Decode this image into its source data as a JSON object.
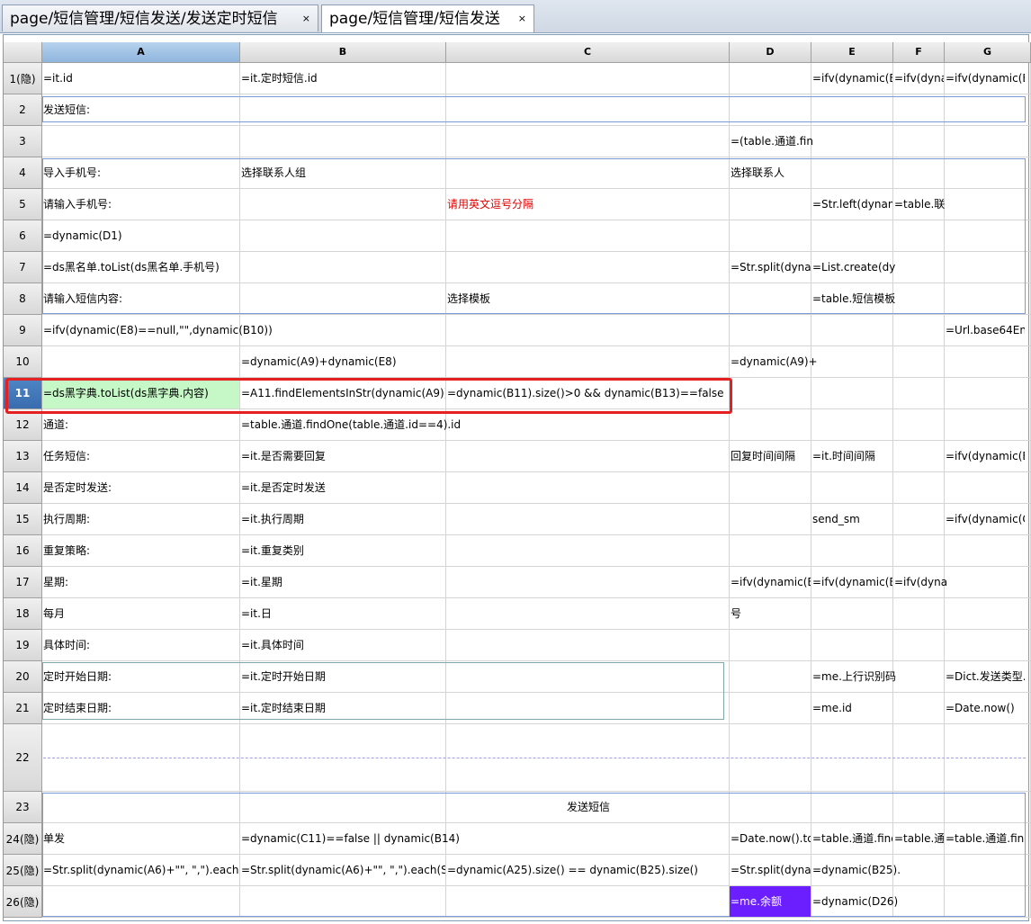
{
  "tabs": [
    {
      "label": "page/短信管理/短信发送/发送定时短信",
      "active": false
    },
    {
      "label": "page/短信管理/短信发送",
      "active": true
    }
  ],
  "close_glyph": "×",
  "columns": [
    "A",
    "B",
    "C",
    "D",
    "E",
    "F",
    "G"
  ],
  "selected_column": "A",
  "selected_row": 11,
  "rows": [
    {
      "n": 1,
      "label": "1(隐)",
      "h": 35
    },
    {
      "n": 2,
      "label": "2",
      "h": 35
    },
    {
      "n": 3,
      "label": "3",
      "h": 35
    },
    {
      "n": 4,
      "label": "4",
      "h": 35
    },
    {
      "n": 5,
      "label": "5",
      "h": 35
    },
    {
      "n": 6,
      "label": "6",
      "h": 35
    },
    {
      "n": 7,
      "label": "7",
      "h": 35
    },
    {
      "n": 8,
      "label": "8",
      "h": 35
    },
    {
      "n": 9,
      "label": "9",
      "h": 35
    },
    {
      "n": 10,
      "label": "10",
      "h": 35
    },
    {
      "n": 11,
      "label": "11",
      "h": 35
    },
    {
      "n": 12,
      "label": "12",
      "h": 35
    },
    {
      "n": 13,
      "label": "13",
      "h": 35
    },
    {
      "n": 14,
      "label": "14",
      "h": 35
    },
    {
      "n": 15,
      "label": "15",
      "h": 35
    },
    {
      "n": 16,
      "label": "16",
      "h": 35
    },
    {
      "n": 17,
      "label": "17",
      "h": 35
    },
    {
      "n": 18,
      "label": "18",
      "h": 35
    },
    {
      "n": 19,
      "label": "19",
      "h": 35
    },
    {
      "n": 20,
      "label": "20",
      "h": 35
    },
    {
      "n": 21,
      "label": "21",
      "h": 35
    },
    {
      "n": 22,
      "label": "22",
      "h": 75
    },
    {
      "n": 23,
      "label": "23",
      "h": 35
    },
    {
      "n": 24,
      "label": "24(隐)",
      "h": 35
    },
    {
      "n": 25,
      "label": "25(隐)",
      "h": 35
    },
    {
      "n": 26,
      "label": "26(隐)",
      "h": 35
    }
  ],
  "cells": [
    {
      "r": 1,
      "c": "A",
      "t": "=it.id"
    },
    {
      "r": 1,
      "c": "B",
      "t": "=it.定时短信.id"
    },
    {
      "r": 1,
      "c": "E",
      "t": "=ifv(dynamic(B"
    },
    {
      "r": 1,
      "c": "F",
      "t": "=ifv(dyna"
    },
    {
      "r": 1,
      "c": "G",
      "t": "=ifv(dynamic(B"
    },
    {
      "r": 2,
      "c": "A",
      "t": "发送短信:"
    },
    {
      "r": 3,
      "c": "D",
      "t": "=(table.通道.fin"
    },
    {
      "r": 4,
      "c": "A",
      "t": "导入手机号:"
    },
    {
      "r": 4,
      "c": "B",
      "t": "选择联系人组"
    },
    {
      "r": 4,
      "c": "D",
      "t": "选择联系人"
    },
    {
      "r": 5,
      "c": "A",
      "t": "请输入手机号:"
    },
    {
      "r": 5,
      "c": "C",
      "t": "请用英文逗号分隔",
      "style": "red"
    },
    {
      "r": 5,
      "c": "E",
      "t": "=Str.left(dynam"
    },
    {
      "r": 5,
      "c": "F",
      "t": "=table.联"
    },
    {
      "r": 6,
      "c": "A",
      "t": "=dynamic(D1)"
    },
    {
      "r": 7,
      "c": "A",
      "t": "=ds黑名单.toList(ds黑名单.手机号)"
    },
    {
      "r": 7,
      "c": "D",
      "t": "=Str.split(dyna"
    },
    {
      "r": 7,
      "c": "E",
      "t": "=List.create(dy"
    },
    {
      "r": 8,
      "c": "A",
      "t": "请输入短信内容:"
    },
    {
      "r": 8,
      "c": "C",
      "t": "选择模板"
    },
    {
      "r": 8,
      "c": "E",
      "t": "=table.短信模板"
    },
    {
      "r": 9,
      "c": "A",
      "t": "=ifv(dynamic(E8)==null,\"\",dynamic(B10))"
    },
    {
      "r": 9,
      "c": "G",
      "t": "=Url.base64En"
    },
    {
      "r": 10,
      "c": "B",
      "t": "=dynamic(A9)+dynamic(E8)"
    },
    {
      "r": 10,
      "c": "D",
      "t": "=dynamic(A9)+"
    },
    {
      "r": 11,
      "c": "A",
      "t": "=ds黑字典.toList(ds黑字典.内容)",
      "style": "green"
    },
    {
      "r": 11,
      "c": "B",
      "t": "=A11.findElementsInStr(dynamic(A9))"
    },
    {
      "r": 11,
      "c": "C",
      "t": "=dynamic(B11).size()>0 && dynamic(B13)==false"
    },
    {
      "r": 12,
      "c": "A",
      "t": "通道:"
    },
    {
      "r": 12,
      "c": "B",
      "t": "=table.通道.findOne(table.通道.id==4).id"
    },
    {
      "r": 13,
      "c": "A",
      "t": "任务短信:"
    },
    {
      "r": 13,
      "c": "B",
      "t": "=it.是否需要回复"
    },
    {
      "r": 13,
      "c": "D",
      "t": "回复时间间隔"
    },
    {
      "r": 13,
      "c": "E",
      "t": "=it.时间间隔"
    },
    {
      "r": 13,
      "c": "G",
      "t": "=ifv(dynamic(B"
    },
    {
      "r": 14,
      "c": "A",
      "t": "是否定时发送:"
    },
    {
      "r": 14,
      "c": "B",
      "t": "=it.是否定时发送"
    },
    {
      "r": 15,
      "c": "A",
      "t": "执行周期:"
    },
    {
      "r": 15,
      "c": "B",
      "t": "=it.执行周期"
    },
    {
      "r": 15,
      "c": "E",
      "t": "send_sm"
    },
    {
      "r": 15,
      "c": "G",
      "t": "=ifv(dynamic(C"
    },
    {
      "r": 16,
      "c": "A",
      "t": "重复策略:"
    },
    {
      "r": 16,
      "c": "B",
      "t": "=it.重复类别"
    },
    {
      "r": 17,
      "c": "A",
      "t": "星期:"
    },
    {
      "r": 17,
      "c": "B",
      "t": "=it.星期"
    },
    {
      "r": 17,
      "c": "D",
      "t": "=ifv(dynamic(B"
    },
    {
      "r": 17,
      "c": "E",
      "t": "=ifv(dynamic(B"
    },
    {
      "r": 17,
      "c": "F",
      "t": "=ifv(dyna"
    },
    {
      "r": 18,
      "c": "A",
      "t": "每月"
    },
    {
      "r": 18,
      "c": "B",
      "t": "=it.日"
    },
    {
      "r": 18,
      "c": "D",
      "t": "号"
    },
    {
      "r": 19,
      "c": "A",
      "t": "具体时间:"
    },
    {
      "r": 19,
      "c": "B",
      "t": "=it.具体时间"
    },
    {
      "r": 20,
      "c": "A",
      "t": "定时开始日期:"
    },
    {
      "r": 20,
      "c": "B",
      "t": "=it.定时开始日期"
    },
    {
      "r": 20,
      "c": "E",
      "t": "=me.上行识别码"
    },
    {
      "r": 20,
      "c": "G",
      "t": "=Dict.发送类型."
    },
    {
      "r": 21,
      "c": "A",
      "t": "定时结束日期:"
    },
    {
      "r": 21,
      "c": "B",
      "t": "=it.定时结束日期"
    },
    {
      "r": 21,
      "c": "E",
      "t": "=me.id"
    },
    {
      "r": 21,
      "c": "G",
      "t": "=Date.now()"
    },
    {
      "r": 23,
      "c": "C",
      "t": "发送短信",
      "style": "center"
    },
    {
      "r": 24,
      "c": "A",
      "t": "单发"
    },
    {
      "r": 24,
      "c": "B",
      "t": "=dynamic(C11)==false || dynamic(B14)"
    },
    {
      "r": 24,
      "c": "D",
      "t": "=Date.now().to"
    },
    {
      "r": 24,
      "c": "E",
      "t": "=table.通道.find"
    },
    {
      "r": 24,
      "c": "F",
      "t": "=table.通"
    },
    {
      "r": 24,
      "c": "G",
      "t": "=table.通道.find"
    },
    {
      "r": 25,
      "c": "A",
      "t": "=Str.split(dynamic(A6)+\"\", \",\").each(Str"
    },
    {
      "r": 25,
      "c": "B",
      "t": "=Str.split(dynamic(A6)+\"\", \",\").each(Str.t"
    },
    {
      "r": 25,
      "c": "C",
      "t": "=dynamic(A25).size() == dynamic(B25).size()"
    },
    {
      "r": 25,
      "c": "D",
      "t": "=Str.split(dyna"
    },
    {
      "r": 25,
      "c": "E",
      "t": "=dynamic(B25)."
    },
    {
      "r": 26,
      "c": "D",
      "t": "=me.余额",
      "style": "purple"
    },
    {
      "r": 26,
      "c": "E",
      "t": "=dynamic(D26)"
    }
  ]
}
